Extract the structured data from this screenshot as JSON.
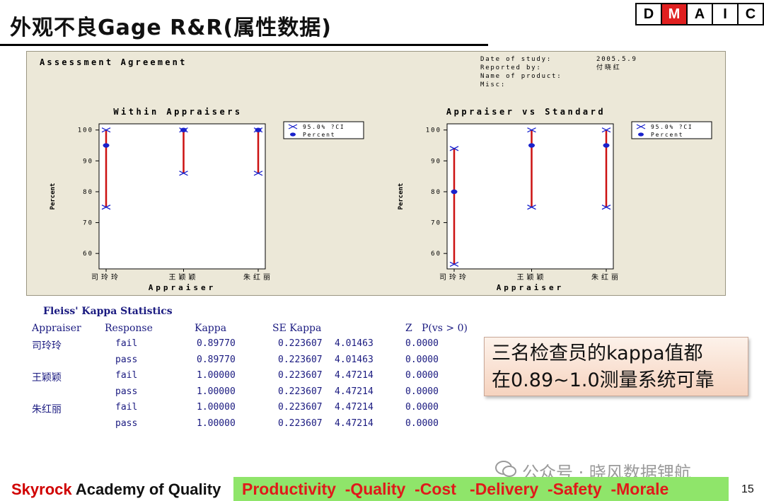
{
  "slide": {
    "title": "外观不良Gage R&R(属性数据)",
    "dmaic": [
      "D",
      "M",
      "A",
      "I",
      "C"
    ],
    "dmaic_active": "M",
    "page_number": "15"
  },
  "report": {
    "heading": "Assessment Agreement",
    "meta_labels": [
      "Date of study:",
      "Reported by:",
      "Name of product:",
      "Misc:"
    ],
    "meta_values": [
      "2005.5.9",
      "付 晓 红",
      "",
      ""
    ],
    "legend": [
      "95.0% ?CI",
      "Percent"
    ]
  },
  "chart_data": [
    {
      "type": "scatter",
      "title": "Within Appraisers",
      "xlabel": "Appraiser",
      "ylabel": "Percent",
      "categories": [
        "司玲玲",
        "王颖颖",
        "朱红丽"
      ],
      "percent": [
        95,
        100,
        100
      ],
      "ci_upper": [
        100,
        100,
        100
      ],
      "ci_lower": [
        75,
        86,
        86
      ],
      "ylim": [
        55,
        102
      ],
      "yticks": [
        60,
        70,
        80,
        90,
        100
      ]
    },
    {
      "type": "scatter",
      "title": "Appraiser vs Standard",
      "xlabel": "Appraiser",
      "ylabel": "Percent",
      "categories": [
        "司玲玲",
        "王颖颖",
        "朱红丽"
      ],
      "percent": [
        80,
        95,
        95
      ],
      "ci_upper": [
        94,
        100,
        100
      ],
      "ci_lower": [
        56.5,
        75,
        75
      ],
      "ylim": [
        55,
        102
      ],
      "yticks": [
        60,
        70,
        80,
        90,
        100
      ]
    }
  ],
  "kappa_stats": {
    "title": "Fleiss' Kappa Statistics",
    "headers": [
      "Appraiser",
      "Response",
      "Kappa",
      "SE Kappa",
      "Z",
      "P(vs > 0)"
    ],
    "rows": [
      {
        "appraiser": "司玲玲",
        "response": "fail",
        "kappa": "0.89770",
        "se": "0.223607",
        "z": "4.01463",
        "p": "0.0000"
      },
      {
        "appraiser": "",
        "response": "pass",
        "kappa": "0.89770",
        "se": "0.223607",
        "z": "4.01463",
        "p": "0.0000"
      },
      {
        "appraiser": "王颖颖",
        "response": "fail",
        "kappa": "1.00000",
        "se": "0.223607",
        "z": "4.47214",
        "p": "0.0000"
      },
      {
        "appraiser": "",
        "response": "pass",
        "kappa": "1.00000",
        "se": "0.223607",
        "z": "4.47214",
        "p": "0.0000"
      },
      {
        "appraiser": "朱红丽",
        "response": "fail",
        "kappa": "1.00000",
        "se": "0.223607",
        "z": "4.47214",
        "p": "0.0000"
      },
      {
        "appraiser": "",
        "response": "pass",
        "kappa": "1.00000",
        "se": "0.223607",
        "z": "4.47214",
        "p": "0.0000"
      }
    ]
  },
  "callout": {
    "line1": "三名检查员的kappa值都",
    "line2": "在0.89~1.0测量系统可靠"
  },
  "footer": {
    "brand_red": "Skyrock",
    "brand_black": " Academy of Quality",
    "slogan": "Productivity  -Quality  -Cost   -Delivery  -Safety  -Morale"
  },
  "watermark": "公众号 · 晓风数据锂航",
  "colors": {
    "ci_line": "#cc1111",
    "point": "#1a22cc",
    "panel_bg": "#ece8d8",
    "footer_bar": "#8fe56a",
    "slogan": "#e01a1a"
  }
}
